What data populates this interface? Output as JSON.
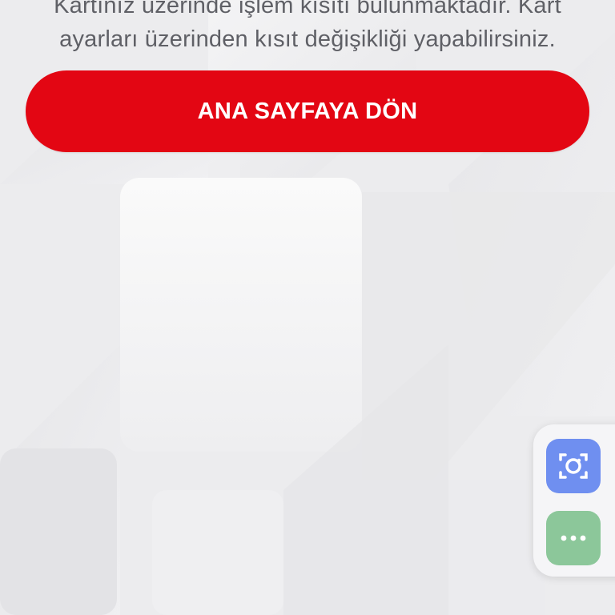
{
  "message": {
    "line1": "Kartınız üzerinde işlem kısıtı bulunmaktadır. Kart",
    "line2": "ayarları üzerinden kısıt değişikliği yapabilirsiniz."
  },
  "home_button": {
    "label": "ANA SAYFAYA DÖN"
  },
  "floating_toolbar": {
    "screenshot_icon": "camera-scan-icon",
    "more_icon": "more-dots-icon"
  },
  "colors": {
    "primary": "#e30613",
    "text": "#5f6066",
    "screenshot_button": "#6f8ff0",
    "more_button": "#8cc79a"
  }
}
